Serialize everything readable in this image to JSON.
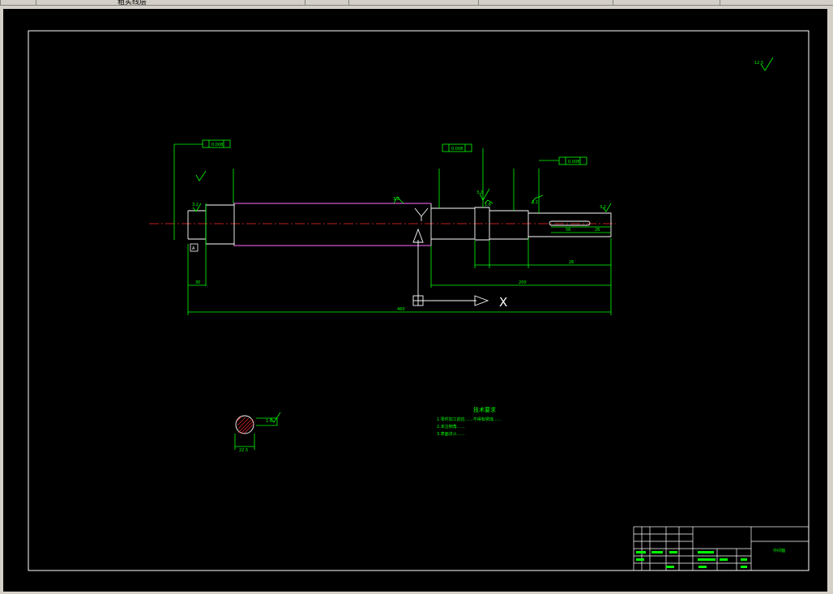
{
  "window": {
    "toolbar_text": "粗实线层",
    "dropdowns": [
      "",
      "",
      ""
    ]
  },
  "drawing": {
    "tech_title": "技术要求",
    "tech_notes": [
      "1.零件加工前应……不得有锈蚀……",
      "2.未注倒角……",
      "3.表面淬火……"
    ],
    "roughness_general": "12.5",
    "roughness_labels": [
      "3.2",
      "3.2",
      "3.2",
      "1.6",
      "3.2",
      "3.2"
    ],
    "tolerance_frames": [
      "0.008",
      "0.008",
      "0.008"
    ],
    "datum": "A",
    "dim_small": [
      "30",
      "26"
    ],
    "dim_overall": "460",
    "dim_mid": "200",
    "keyway_dims": [
      "56",
      "26"
    ],
    "section_label": "1.6",
    "section_dim": "22.5",
    "axis_label": "X",
    "titleblock_name": "中间轴"
  }
}
